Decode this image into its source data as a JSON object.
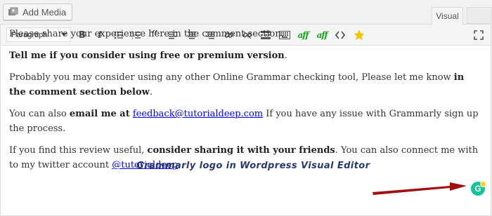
{
  "top": {
    "add_media_label": "Add Media",
    "tabs": [
      {
        "label": "Visual"
      },
      {
        "label": ""
      }
    ]
  },
  "toolbar": {
    "format_value": "Paragraph",
    "icons": [
      "bold-icon",
      "italic-icon",
      "bullet-list-icon",
      "numbered-list-icon",
      "blockquote-icon",
      "align-left-icon",
      "align-center-icon",
      "align-right-icon",
      "link-icon",
      "unlink-icon",
      "read-more-icon",
      "toolbar-toggle-icon",
      "grammar-check-icon",
      "grammar-check-alt-icon",
      "code-icon",
      "star-icon",
      "fullscreen-icon"
    ],
    "aff_label": "aff",
    "accent_colors": {
      "aff": "#19a319",
      "star": "#f2c400",
      "grammarly": "#15c39a"
    }
  },
  "content": {
    "p1": "Please share your experience here in the comment section.",
    "p2_bold": "Tell me if you consider using free or premium version",
    "p2_end": ".",
    "p3_start": "Probably you may consider using any other Online Grammar checking tool, Please let me know ",
    "p3_bold": "in the comment section below",
    "p3_end": ".",
    "p4_start": "You can also ",
    "p4_bold": "email me at",
    "p4_space": " ",
    "p4_link": "feedback@tutorialdeep.com",
    "p4_end": " If you have any issue with Grammarly sign up the process.",
    "p5_start": "If you find this review useful, ",
    "p5_bold": "consider sharing it with your friends",
    "p5_mid": ". You can also connect me with to my twitter account ",
    "p5_link": "@tutorialdeep",
    "p5_end": "."
  },
  "annotation": {
    "text": "Grammarly logo in Wordpress Visual Editor",
    "arrow_color": "#a01010"
  },
  "grammarly": {
    "letter": "G"
  }
}
